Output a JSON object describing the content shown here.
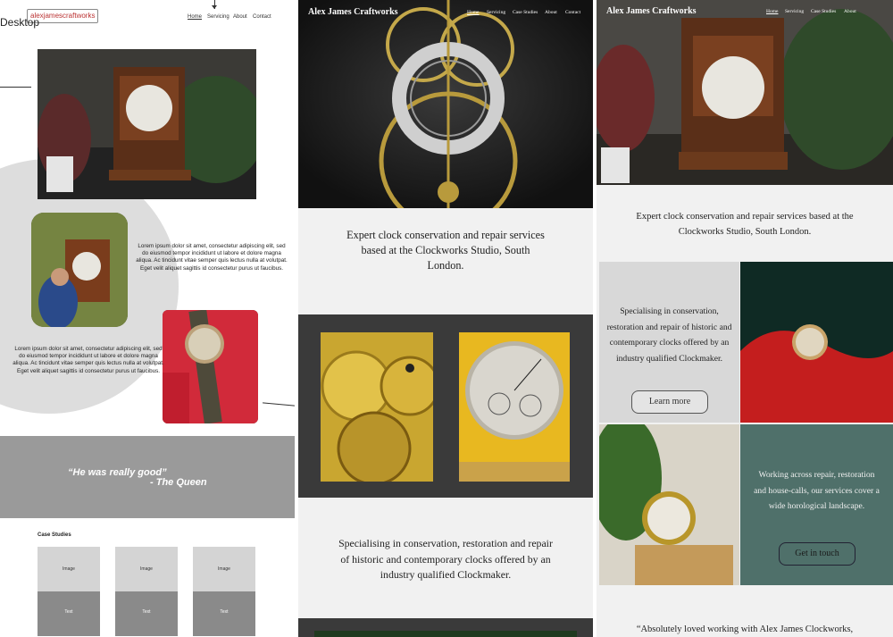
{
  "wireframe": {
    "logo": "alexjamescraftworks",
    "desktop_label": "Desktop",
    "nav": [
      "Home",
      "Servicing",
      "About",
      "Contact"
    ],
    "lorem_1": "Lorem ipsum dolor sit amet, consectetur adipiscing elit, sed do eiusmod tempor incididunt ut labore et dolore magna aliqua. Ac tincidunt vitae semper quis lectus nulla at volutpat. Eget velit aliquet sagittis id consectetur purus ut faucibus.",
    "lorem_2": "Lorem ipsum dolor sit amet, consectetur adipiscing elit, sed do eiusmod tempor incididunt ut labore et dolore magna aliqua. Ac tincidunt vitae semper quis lectus nulla at volutpat. Eget velit aliquet sagittis id consectetur purus ut faucibus.",
    "quote": "“He was really good”",
    "quote_author": "- The Queen",
    "case_studies_title": "Case Studies",
    "card_image_label": "Image",
    "card_text_label": "Text"
  },
  "mobile": {
    "brand": "Alex James Craftworks",
    "nav": [
      "Home",
      "Servicing",
      "Case Studies",
      "About",
      "Contact"
    ],
    "intro": "Expert clock conservation and repair services based at the Clockworks Studio, South London.",
    "specialising": "Specialising in conservation, restoration and repair of historic and contemporary clocks offered by an industry qualified Clockmaker."
  },
  "desktop": {
    "brand": "Alex James Craftworks",
    "nav": [
      "Home",
      "Servicing",
      "Case Studies",
      "About"
    ],
    "intro": "Expert clock conservation and repair services based at the Clockworks Studio, South London.",
    "specialising": "Specialising in conservation, restoration and repair of historic and contemporary clocks offered by an industry qualified Clockmaker.",
    "learn_more": "Learn more",
    "working": "Working across repair, restoration and house-calls, our services cover a wide horological landscape.",
    "get_in_touch": "Get in touch",
    "testimonial": "“Absolutely loved working with Alex James Clockworks,"
  },
  "colors": {
    "wire_grey": "#dddddd",
    "dark_band": "#3a3a3a",
    "teal_block": "#4f706a",
    "light_grey": "#f1f1f1"
  }
}
